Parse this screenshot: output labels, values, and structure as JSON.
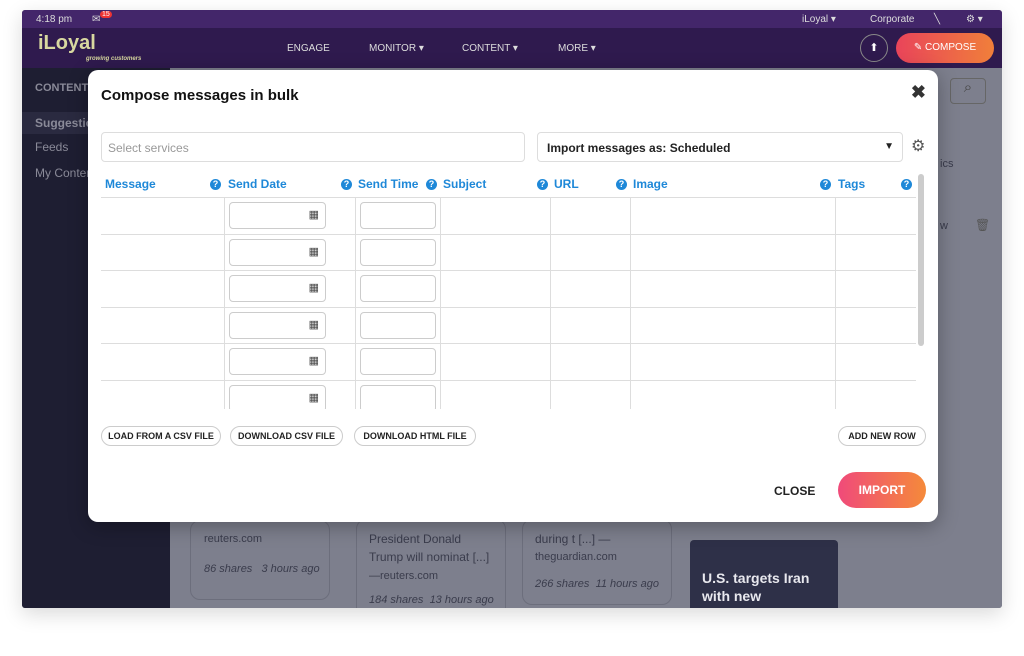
{
  "topbar": {
    "time": "4:18 pm",
    "notifications": "15",
    "account": "iLoyal ▾",
    "workspace": "Corporate",
    "settings": "⚙ ▾"
  },
  "nav": {
    "logo": "iLoyal",
    "tagline": "growing customers",
    "items": [
      "ENGAGE",
      "MONITOR ▾",
      "CONTENT ▾",
      "MORE ▾"
    ],
    "compose": "✎  COMPOSE",
    "accent": "#e9445a"
  },
  "sidebar": {
    "heading": "CONTENT",
    "items": [
      "Suggestions",
      "Feeds",
      "My Content"
    ]
  },
  "background": {
    "partial1": "ics",
    "partial2": "w",
    "cards": [
      {
        "lines": [
          "reuters.com"
        ],
        "shares": "86 shares",
        "age": "3 hours ago"
      },
      {
        "lines": [
          "President Donald",
          "Trump will nominat [...]",
          "—reuters.com"
        ],
        "shares": "184 shares",
        "age": "13 hours ago"
      },
      {
        "lines": [
          "during t [...] —",
          "theguardian.com"
        ],
        "shares": "266 shares",
        "age": "11 hours ago"
      },
      {
        "lines": [
          "U.S. targets Iran",
          "with new"
        ]
      }
    ]
  },
  "modal": {
    "title": "Compose messages in bulk",
    "services_placeholder": "Select services",
    "import_as": "Import messages as: Scheduled",
    "columns": [
      "Message",
      "Send Date",
      "Send Time",
      "Subject",
      "URL",
      "Image",
      "Tags"
    ],
    "buttons": {
      "load_csv": "LOAD FROM A CSV FILE",
      "download_csv": "DOWNLOAD CSV FILE",
      "download_html": "DOWNLOAD HTML FILE",
      "add_row": "ADD NEW ROW",
      "close": "CLOSE",
      "import": "IMPORT"
    }
  }
}
